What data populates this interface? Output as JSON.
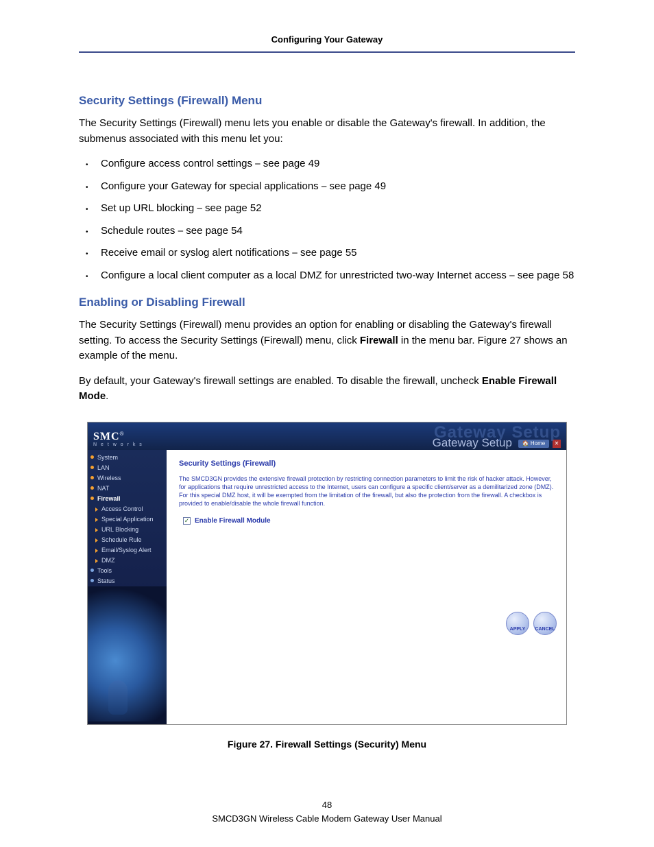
{
  "header": {
    "title": "Configuring Your Gateway"
  },
  "section1": {
    "heading": "Security Settings (Firewall) Menu",
    "intro": "The Security Settings (Firewall) menu lets you enable or disable the Gateway's firewall. In addition, the submenus associated with this menu let you:",
    "bullets": [
      "Configure access control settings ⎯ see page 49",
      "Configure your Gateway for special applications ⎯ see page 49",
      "Set up URL blocking ⎯ see page 52",
      "Schedule routes ⎯ see page 54",
      "Receive email or syslog alert notifications ⎯ see page 55",
      "Configure a local client computer as a local DMZ for unrestricted two-way Internet access ⎯ see page 58"
    ]
  },
  "section2": {
    "heading": "Enabling or Disabling Firewall",
    "para1_pre": "The Security Settings (Firewall) menu provides an option for enabling or disabling the Gateway's firewall setting. To access the Security Settings (Firewall) menu, click ",
    "para1_bold": "Firewall",
    "para1_post": " in the menu bar. Figure 27 shows an example of the menu.",
    "para2_pre": "By default, your Gateway's firewall settings are enabled. To disable the firewall, uncheck ",
    "para2_bold": "Enable Firewall Mode",
    "para2_post": "."
  },
  "screenshot": {
    "logo": {
      "main": "SMC",
      "reg": "®",
      "sub": "N e t w o r k s"
    },
    "bgtext": "Gateway Setup",
    "title": "Gateway Setup",
    "home": "Home",
    "nav": {
      "system": "System",
      "lan": "LAN",
      "wireless": "Wireless",
      "nat": "NAT",
      "firewall": "Firewall",
      "access_control": "Access Control",
      "special_app": "Special Application",
      "url_blocking": "URL Blocking",
      "schedule_rule": "Schedule Rule",
      "email_alert": "Email/Syslog Alert",
      "dmz": "DMZ",
      "tools": "Tools",
      "status": "Status"
    },
    "content": {
      "title": "Security Settings (Firewall)",
      "desc": "The SMCD3GN provides the extensive firewall protection by restricting connection parameters to limit the risk of hacker attack. However, for applications that require unrestricted access to the Internet, users can configure a specific client/server as a demilitarized zone (DMZ). For this special DMZ host, it will be exempted from the limitation of the firewall, but also the protection from the firewall. A checkbox is provided to enable/disable the whole firewall function.",
      "checkbox": "Enable Firewall Module",
      "apply": "APPLY",
      "cancel": "CANCEL"
    }
  },
  "figure": {
    "caption": "Figure 27. Firewall Settings (Security) Menu"
  },
  "footer": {
    "page": "48",
    "book": "SMCD3GN Wireless Cable Modem Gateway User Manual"
  }
}
